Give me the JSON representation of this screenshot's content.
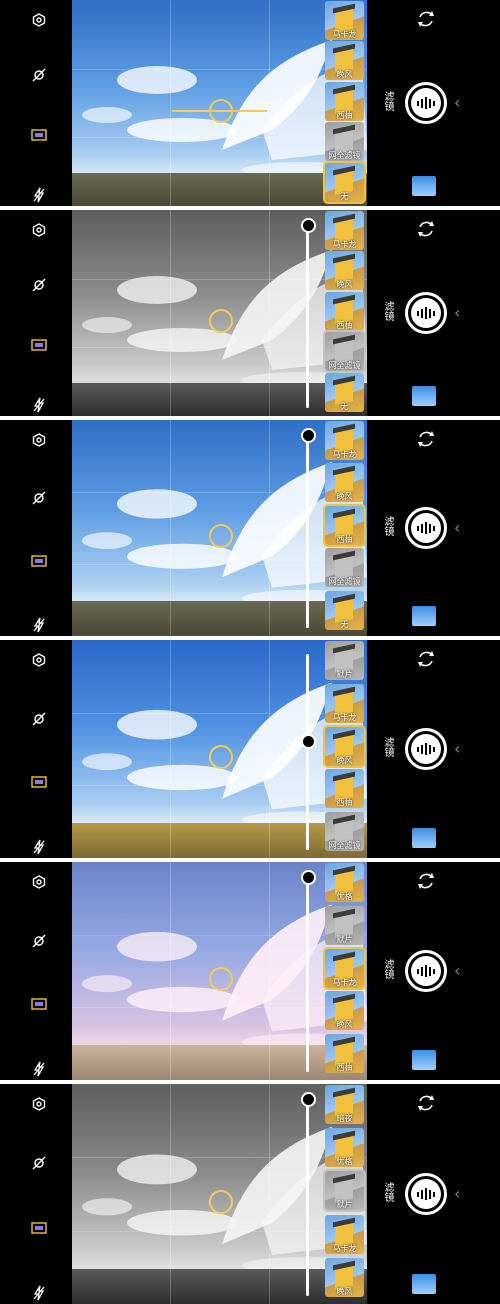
{
  "panels": [
    {
      "filter_style": "color",
      "slider_visible": false,
      "thumbnails": [
        {
          "label": "马卡龙",
          "selected": false,
          "grey": false
        },
        {
          "label": "晚风",
          "selected": false,
          "grey": false
        },
        {
          "label": "西柚",
          "selected": false,
          "grey": false
        },
        {
          "label": "网全滤镜",
          "selected": false,
          "grey": true
        },
        {
          "label": "无",
          "selected": true,
          "grey": false
        }
      ],
      "mode_label": "滤镜"
    },
    {
      "filter_style": "bw",
      "slider_visible": true,
      "thumbnails": [
        {
          "label": "马卡龙",
          "selected": false,
          "grey": false
        },
        {
          "label": "晚风",
          "selected": false,
          "grey": false
        },
        {
          "label": "西柚",
          "selected": false,
          "grey": false
        },
        {
          "label": "网全滤镜",
          "selected": true,
          "grey": true
        },
        {
          "label": "无",
          "selected": false,
          "grey": false
        }
      ],
      "mode_label": "滤镜"
    },
    {
      "filter_style": "color",
      "slider_visible": true,
      "thumbnails": [
        {
          "label": "马卡龙",
          "selected": false,
          "grey": false
        },
        {
          "label": "晚风",
          "selected": false,
          "grey": false
        },
        {
          "label": "西柚",
          "selected": true,
          "grey": false
        },
        {
          "label": "网全滤镜",
          "selected": false,
          "grey": true
        },
        {
          "label": "无",
          "selected": false,
          "grey": false
        }
      ],
      "mode_label": "滤镜"
    },
    {
      "filter_style": "warm",
      "slider_visible": true,
      "thumbnails": [
        {
          "label": "默片",
          "selected": false,
          "grey": true
        },
        {
          "label": "马卡龙",
          "selected": false,
          "grey": false
        },
        {
          "label": "晚风",
          "selected": true,
          "grey": false
        },
        {
          "label": "西柚",
          "selected": false,
          "grey": false
        },
        {
          "label": "网全滤镜",
          "selected": false,
          "grey": true
        }
      ],
      "mode_label": "滤镜"
    },
    {
      "filter_style": "pink",
      "slider_visible": true,
      "thumbnails": [
        {
          "label": "优格",
          "selected": false,
          "grey": false
        },
        {
          "label": "默片",
          "selected": false,
          "grey": true
        },
        {
          "label": "马卡龙",
          "selected": true,
          "grey": false
        },
        {
          "label": "晚风",
          "selected": false,
          "grey": false
        },
        {
          "label": "西柚",
          "selected": false,
          "grey": false
        }
      ],
      "mode_label": "滤镜"
    },
    {
      "filter_style": "bw",
      "slider_visible": true,
      "thumbnails": [
        {
          "label": "暗夜",
          "selected": false,
          "grey": false
        },
        {
          "label": "优格",
          "selected": false,
          "grey": false
        },
        {
          "label": "默片",
          "selected": true,
          "grey": true
        },
        {
          "label": "马卡龙",
          "selected": false,
          "grey": false
        },
        {
          "label": "晚风",
          "selected": false,
          "grey": false
        }
      ],
      "mode_label": "滤镜"
    }
  ]
}
